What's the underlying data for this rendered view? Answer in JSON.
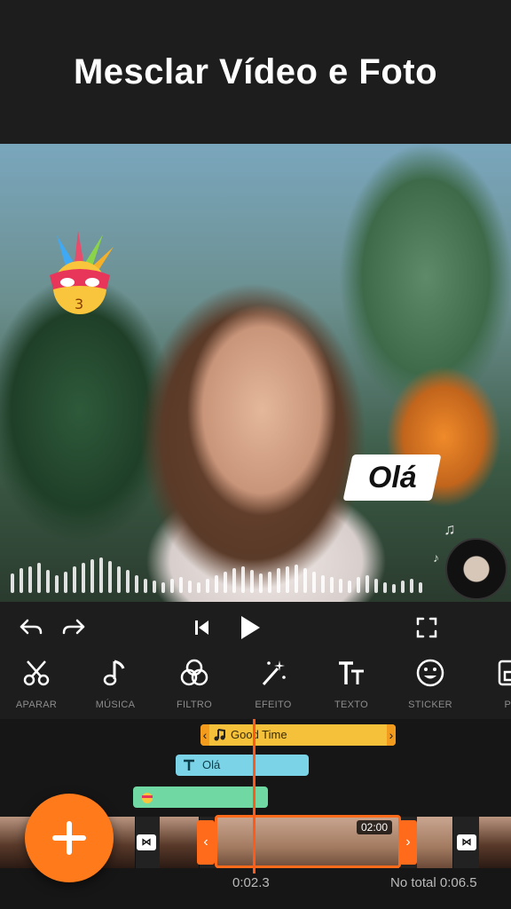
{
  "header": {
    "title": "Mesclar Vídeo e Foto"
  },
  "preview": {
    "text_sticker": "Olá"
  },
  "tools": [
    {
      "label": "APARAR",
      "icon": "scissors-icon"
    },
    {
      "label": "MÚSICA",
      "icon": "music-note-icon"
    },
    {
      "label": "FILTRO",
      "icon": "filter-circles-icon"
    },
    {
      "label": "EFEITO",
      "icon": "magic-wand-icon"
    },
    {
      "label": "TEXTO",
      "icon": "text-icon"
    },
    {
      "label": "STICKER",
      "icon": "smiley-icon"
    },
    {
      "label": "PI",
      "icon": "pip-icon"
    }
  ],
  "timeline": {
    "music_track_label": "Good Time",
    "text_track_label": "Olá",
    "clip_duration": "02:00",
    "current_time": "0:02.3",
    "total_time": "No total 0:06.5"
  },
  "colors": {
    "accent": "#ff6b1a",
    "music_track": "#f5c03a",
    "text_track": "#7ad3e6",
    "sticker_track": "#6fd8a3"
  }
}
